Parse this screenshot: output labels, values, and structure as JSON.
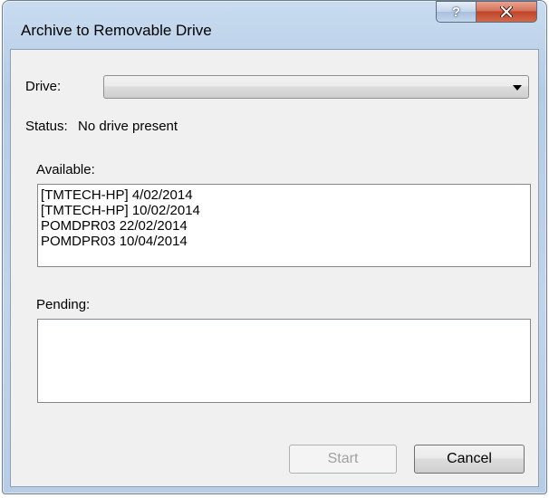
{
  "window": {
    "title": "Archive to Removable Drive",
    "help_glyph": "?",
    "icons": [
      "help-icon",
      "close-icon"
    ]
  },
  "drive": {
    "label": "Drive:",
    "value": ""
  },
  "status": {
    "label": "Status:",
    "value": "No drive present"
  },
  "available": {
    "label": "Available:",
    "items": [
      "[TMTECH-HP] 4/02/2014",
      "[TMTECH-HP] 10/02/2014",
      "POMDPR03 22/02/2014",
      "POMDPR03 10/04/2014"
    ]
  },
  "pending": {
    "label": "Pending:",
    "items": []
  },
  "buttons": {
    "start_label": "Start",
    "start_enabled": false,
    "cancel_label": "Cancel"
  },
  "colors": {
    "window_frame": "#b4cce6",
    "client_background": "#f0f0f0",
    "close_button": "#c0442a"
  }
}
